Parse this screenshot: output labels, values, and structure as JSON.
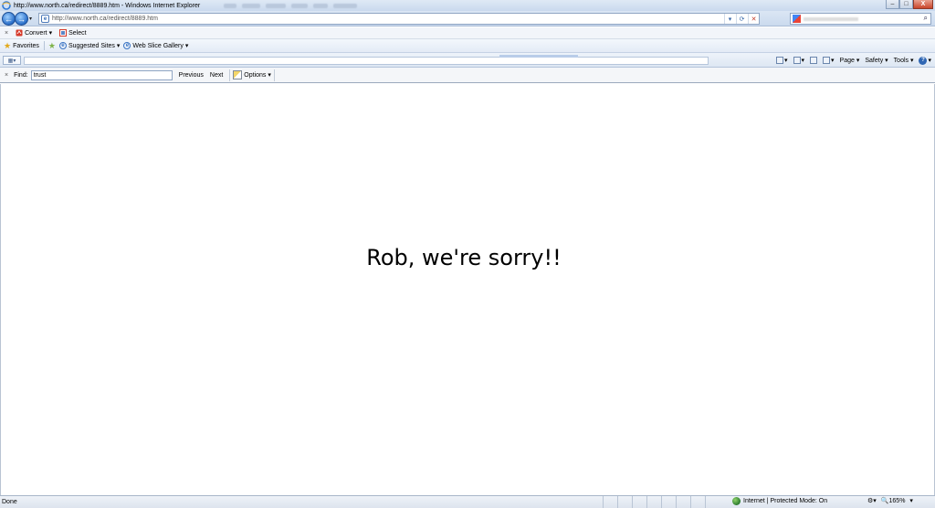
{
  "window": {
    "title": "http://www.north.ca/redirect/8889.htm - Windows Internet Explorer",
    "controls": {
      "minimize": "–",
      "maximize": "□",
      "close": "X"
    }
  },
  "address_bar": {
    "url": "http://www.north.ca/redirect/8889.htm",
    "back_glyph": "←",
    "forward_glyph": "→",
    "dropdown_glyph": "▾",
    "refresh_glyph": "⟳",
    "stop_glyph": "✕",
    "search_glyph": "⌕"
  },
  "convert_bar": {
    "close_glyph": "×",
    "convert_label": "Convert",
    "convert_dropdown": "▾",
    "select_label": "Select"
  },
  "favorites_bar": {
    "favorites_label": "Favorites",
    "suggested_sites_label": "Suggested Sites ▾",
    "web_slice_gallery_label": "Web Slice Gallery ▾"
  },
  "command_bar": {
    "page_label": "Page ▾",
    "safety_label": "Safety ▾",
    "tools_label": "Tools ▾",
    "help_glyph": "?"
  },
  "find_bar": {
    "close_glyph": "×",
    "find_label": "Find:",
    "find_value": "trust",
    "previous_label": "Previous",
    "next_label": "Next",
    "options_label": "Options ▾"
  },
  "page": {
    "message": "Rob, we're sorry!!"
  },
  "status_bar": {
    "status_text": "Done",
    "zone_text": "Internet | Protected Mode: On",
    "zoom_text": "165%",
    "zoom_dropdown": "▾"
  }
}
